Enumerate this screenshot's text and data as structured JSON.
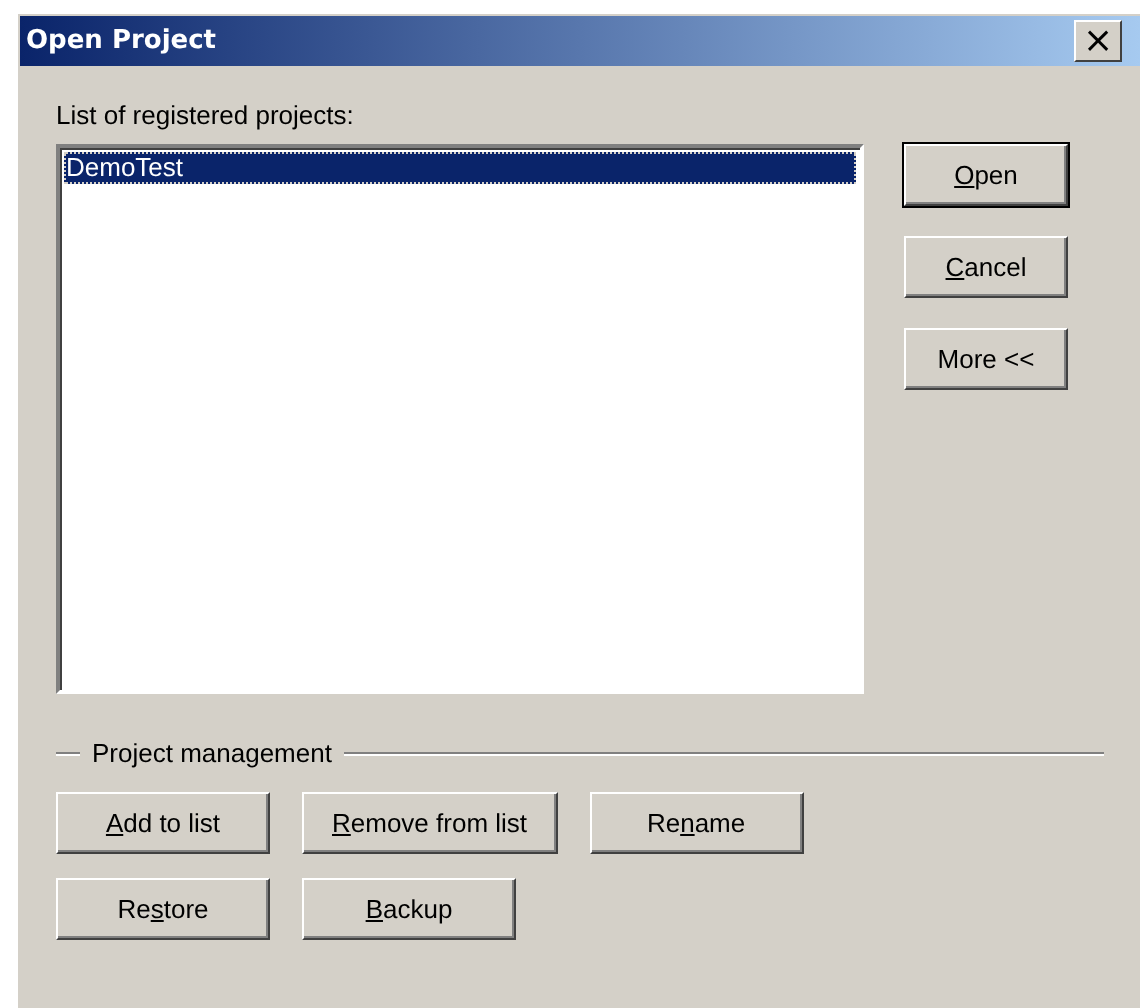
{
  "window": {
    "title": "Open Project",
    "close_label": "×"
  },
  "projects": {
    "label": "List of registered projects:",
    "items": [
      {
        "name": "DemoTest",
        "selected": true
      }
    ]
  },
  "side_buttons": [
    {
      "access_key": "O",
      "text_after": "pen",
      "default": true
    },
    {
      "access_key": "C",
      "text_after": "ancel",
      "default": false
    },
    {
      "text_before": "More <<",
      "default": false
    }
  ],
  "management": {
    "title": "Project management",
    "rows": [
      [
        {
          "access_key": "A",
          "text_after": "dd to list"
        },
        {
          "access_key": "R",
          "text_after": "emove from list"
        },
        {
          "text_before": "Re",
          "access_key": "n",
          "text_after": "ame"
        }
      ],
      [
        {
          "text_before": "Re",
          "access_key": "s",
          "text_after": "tore"
        },
        {
          "access_key": "B",
          "text_after": "ackup"
        }
      ]
    ]
  }
}
